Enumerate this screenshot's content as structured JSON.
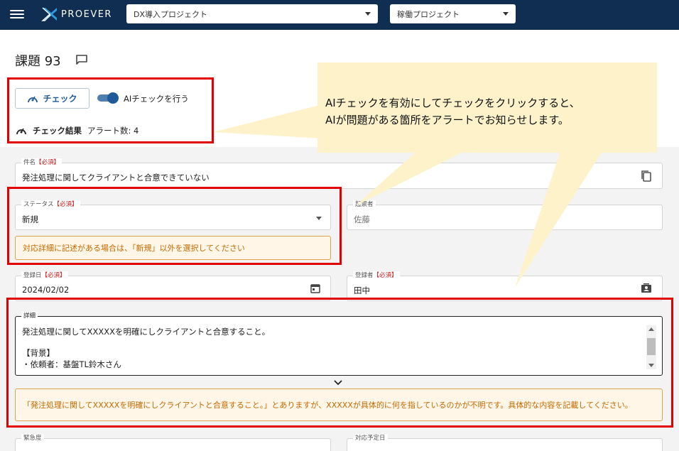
{
  "header": {
    "brand": "PROEVER",
    "project_select": "DX導入プロジェクト",
    "status_select": "稼働プロジェクト"
  },
  "page": {
    "title": "課題 93"
  },
  "check": {
    "button_label": "チェック",
    "toggle_label": "AIチェックを行う",
    "toggle_on": true,
    "result_label": "チェック結果",
    "result_value": "アラート数: 4"
  },
  "callout": {
    "line1": "AIチェックを有効にしてチェックをクリックすると、",
    "line2": "AIが問題がある箇所をアラートでお知らせします。"
  },
  "form": {
    "subject": {
      "label": "件名",
      "required": "【必須】",
      "value": "発注処理に関してクライアントと合意できていない"
    },
    "status": {
      "label": "ステータス",
      "required": "【必須】",
      "value": "新規",
      "alert": "対応詳細に記述がある場合は、「新規」以外を選択してください"
    },
    "reporter": {
      "label": "起票者",
      "value": "佐藤"
    },
    "registered_date": {
      "label": "登録日",
      "required": "【必須】",
      "value": "2024/02/02"
    },
    "registrant": {
      "label": "登録者",
      "required": "【必須】",
      "value": "田中"
    },
    "detail": {
      "label": "詳細",
      "line1": "発注処理に関してXXXXXを明確にしクライアントと合意すること。",
      "line2": "",
      "line3": "【背景】",
      "line4": "・依頼者：基盤TL鈴木さん",
      "alert": "「発注処理に関してXXXXXを明確にしクライアントと合意すること。」とありますが、XXXXXが具体的に何を指しているのかが不明です。具体的な内容を記載してください。"
    },
    "urgency": {
      "label": "緊急度"
    },
    "due_date": {
      "label": "対応予定日"
    }
  },
  "colors": {
    "header_bg": "#0f2e52",
    "accent": "#1f5b9a",
    "highlight_red": "#e00000",
    "alert_text": "#c56a00",
    "callout_bg": "#fdf2c9"
  }
}
